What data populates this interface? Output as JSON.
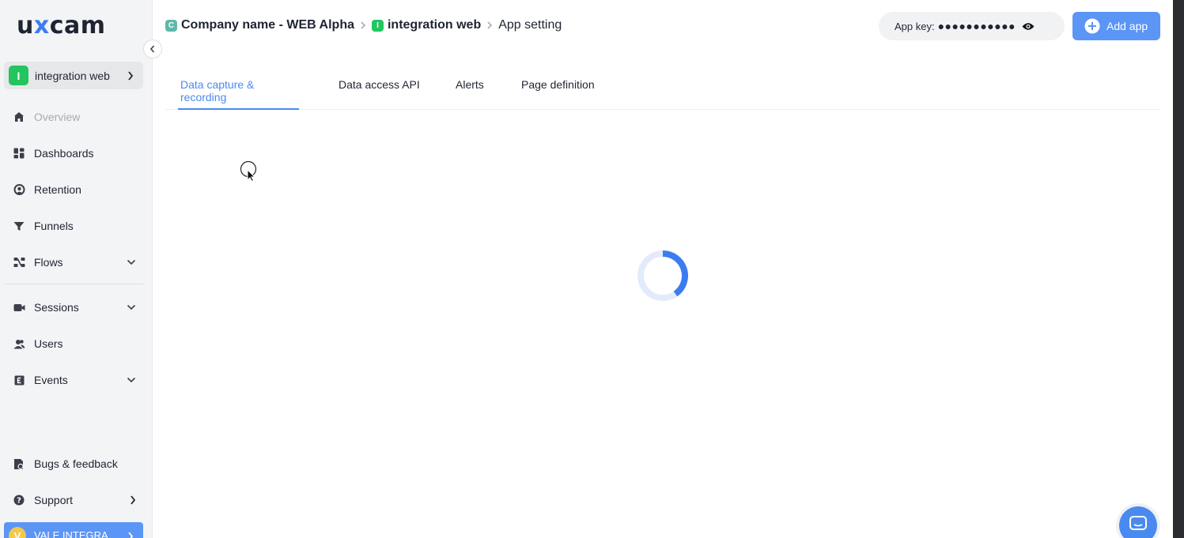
{
  "brand": {
    "logo_pre": "u",
    "logo_x": "x",
    "logo_post": "cam"
  },
  "sidebar": {
    "app_switcher": {
      "badge": "I",
      "name": "integration web"
    },
    "items": [
      {
        "label": "Overview",
        "icon": "home-icon"
      },
      {
        "label": "Dashboards",
        "icon": "dashboard-icon"
      },
      {
        "label": "Retention",
        "icon": "retention-icon"
      },
      {
        "label": "Funnels",
        "icon": "funnel-icon"
      },
      {
        "label": "Flows",
        "icon": "flows-icon"
      },
      {
        "label": "Sessions",
        "icon": "video-icon"
      },
      {
        "label": "Users",
        "icon": "users-icon"
      },
      {
        "label": "Events",
        "icon": "events-icon"
      }
    ],
    "footer": [
      {
        "label": "Bugs & feedback",
        "icon": "bug-report-icon"
      },
      {
        "label": "Support",
        "icon": "help-icon"
      }
    ],
    "user": {
      "avatar": "V",
      "name": "VALE INTEGRA"
    }
  },
  "breadcrumb": {
    "company_badge": "C",
    "company": "Company name - WEB Alpha",
    "app_badge": "I",
    "app": "integration web",
    "page": "App setting"
  },
  "header": {
    "app_key_label": "App key:",
    "app_key_masked": "●●●●●●●●●●●",
    "add_app_label": "Add app"
  },
  "tabs": [
    {
      "label": "Data capture & recording",
      "active": true
    },
    {
      "label": "Data access API",
      "active": false
    },
    {
      "label": "Alerts",
      "active": false
    },
    {
      "label": "Page definition",
      "active": false
    }
  ],
  "colors": {
    "accent": "#4a8af0",
    "app_badge": "#22c55e",
    "company_badge": "#5fb8a8",
    "user_bar": "#5b95f5"
  }
}
